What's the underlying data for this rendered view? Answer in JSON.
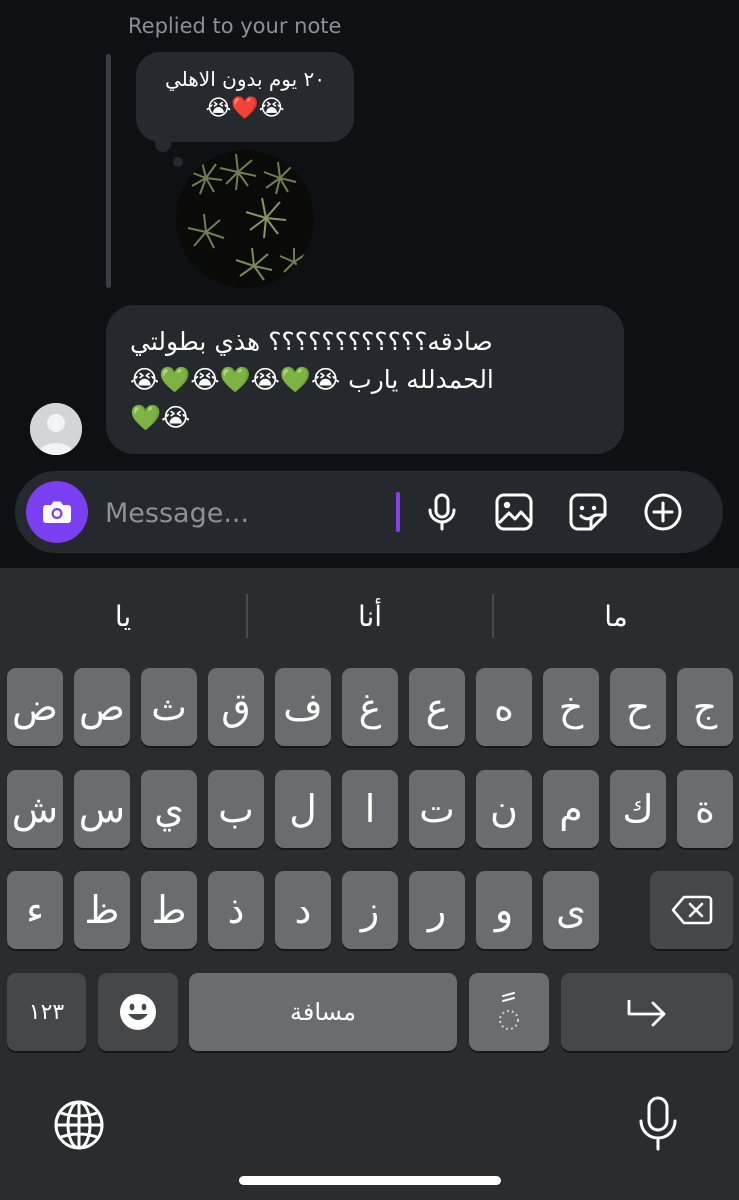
{
  "chat": {
    "replied_label": "Replied to your note",
    "note_text": "٢٠ يوم بدون الاهلي",
    "note_emoji": "😭❤️😭",
    "message_lines": [
      "صادقه؟؟؟؟؟؟؟؟؟؟؟؟ هذي بطولتي",
      "الحمدلله يارب 😭💚😭💚😭💚😭",
      "💚😭"
    ]
  },
  "composer": {
    "placeholder": "Message...",
    "icons": [
      "camera-icon",
      "microphone-icon",
      "gallery-icon",
      "sticker-icon",
      "plus-icon"
    ],
    "accent_color": "#7b3ff2"
  },
  "keyboard": {
    "suggestions": [
      "ما",
      "أنا",
      "يا"
    ],
    "row1": [
      "ج",
      "ح",
      "خ",
      "ه",
      "ع",
      "غ",
      "ف",
      "ق",
      "ث",
      "ص",
      "ض"
    ],
    "row2": [
      "ة",
      "ك",
      "م",
      "ن",
      "ت",
      "ا",
      "ل",
      "ب",
      "ي",
      "س",
      "ش"
    ],
    "row3": [
      "ى",
      "و",
      "ر",
      "ز",
      "د",
      "ذ",
      "ط",
      "ظ",
      "ء"
    ],
    "numbers_key": "١٢٣",
    "space_key": "مسافة",
    "diacritic_key": "ًٍ"
  }
}
